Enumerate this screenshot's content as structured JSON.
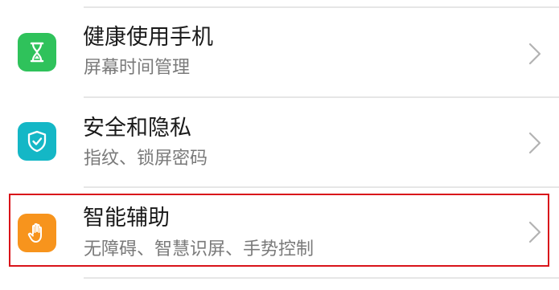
{
  "settings": {
    "items": [
      {
        "title": "健康使用手机",
        "subtitle": "屏幕时间管理",
        "icon": "hourglass-icon",
        "icon_color": "#2fc25b"
      },
      {
        "title": "安全和隐私",
        "subtitle": "指纹、锁屏密码",
        "icon": "shield-check-icon",
        "icon_color": "#14b7c6"
      },
      {
        "title": "智能辅助",
        "subtitle": "无障碍、智慧识屏、手势控制",
        "icon": "hand-icon",
        "icon_color": "#f7941d"
      }
    ]
  },
  "colors": {
    "highlight_border": "#d9141a",
    "divider": "#e6e6e6",
    "chevron": "#b3b3b3"
  }
}
